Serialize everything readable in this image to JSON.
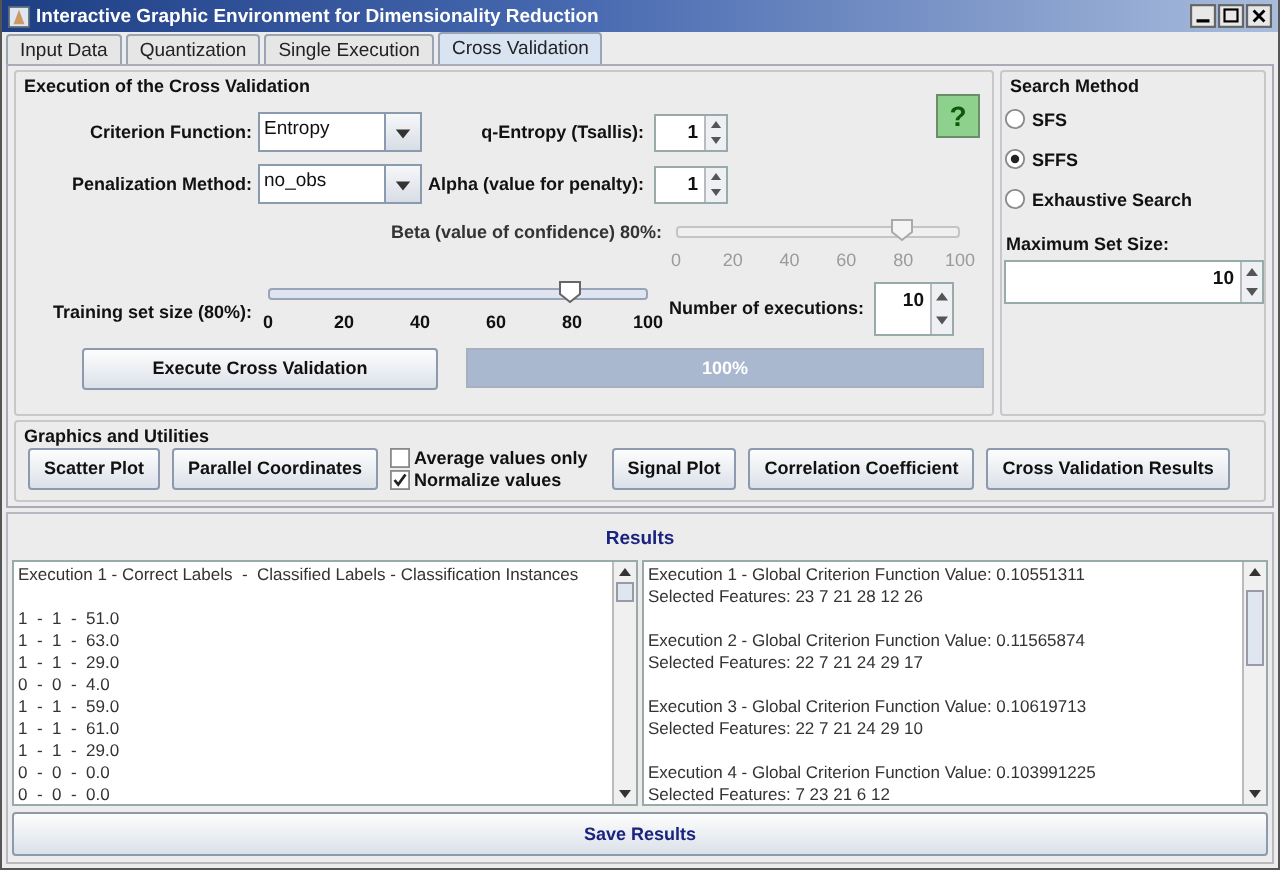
{
  "window": {
    "title": "Interactive Graphic Environment for Dimensionality Reduction"
  },
  "tabs": [
    {
      "label": "Input Data",
      "selected": false
    },
    {
      "label": "Quantization",
      "selected": false
    },
    {
      "label": "Single Execution",
      "selected": false
    },
    {
      "label": "Cross Validation",
      "selected": true
    }
  ],
  "execution": {
    "title": "Execution of the Cross Validation",
    "help_button": "?",
    "criterion_function": {
      "label": "Criterion Function:",
      "value": "Entropy"
    },
    "penalization_method": {
      "label": "Penalization Method:",
      "value": "no_obs"
    },
    "q_entropy": {
      "label": "q-Entropy (Tsallis):",
      "value": "1"
    },
    "alpha": {
      "label": "Alpha (value for penalty):",
      "value": "1"
    },
    "beta": {
      "label": "Beta (value of confidence) 80%:",
      "level": 0.8,
      "disabled": true,
      "ticks": [
        "0",
        "20",
        "40",
        "60",
        "80",
        "100"
      ]
    },
    "training_set_size": {
      "label": "Training set size (80%):",
      "level": 0.8,
      "disabled": false,
      "ticks": [
        "0",
        "20",
        "40",
        "60",
        "80",
        "100"
      ]
    },
    "number_of_executions": {
      "label": "Number of executions:",
      "value": "10"
    },
    "execute_button": "Execute Cross Validation",
    "progress": {
      "level": 1,
      "text": "100%"
    }
  },
  "search_method": {
    "title": "Search Method",
    "options": [
      {
        "label": "SFS",
        "selected": false
      },
      {
        "label": "SFFS",
        "selected": true
      },
      {
        "label": "Exhaustive Search",
        "selected": false
      }
    ],
    "max_set_size": {
      "label": "Maximum Set Size:",
      "value": "10"
    }
  },
  "graphics": {
    "title": "Graphics and Utilities",
    "buttons_left": [
      "Scatter Plot",
      "Parallel Coordinates"
    ],
    "checkboxes": [
      {
        "label": "Average values only",
        "checked": false
      },
      {
        "label": "Normalize values",
        "checked": true
      }
    ],
    "buttons_right": [
      "Signal Plot",
      "Correlation Coefficient",
      "Cross Validation Results"
    ]
  },
  "results": {
    "title": "Results",
    "left_header": "Execution 1 - Correct Labels  -  Classified Labels - Classification Instances",
    "left_rows": [
      "1  -  1  -  51.0",
      "1  -  1  -  63.0",
      "1  -  1  -  29.0",
      "0  -  0  -  4.0",
      "1  -  1  -  59.0",
      "1  -  1  -  61.0",
      "1  -  1  -  29.0",
      "0  -  0  -  0.0",
      "0  -  0  -  0.0"
    ],
    "right_entries": [
      {
        "value": "Execution 1 - Global Criterion Function Value: 0.10551311",
        "features": "Selected Features: 23 7 21 28 12 26"
      },
      {
        "value": "Execution 2 - Global Criterion Function Value: 0.11565874",
        "features": "Selected Features: 22 7 21 24 29 17"
      },
      {
        "value": "Execution 3 - Global Criterion Function Value: 0.10619713",
        "features": "Selected Features: 22 7 21 24 29 10"
      },
      {
        "value": "Execution 4 - Global Criterion Function Value: 0.103991225",
        "features": "Selected Features: 7 23 21 6 12"
      }
    ],
    "save_button": "Save Results"
  }
}
